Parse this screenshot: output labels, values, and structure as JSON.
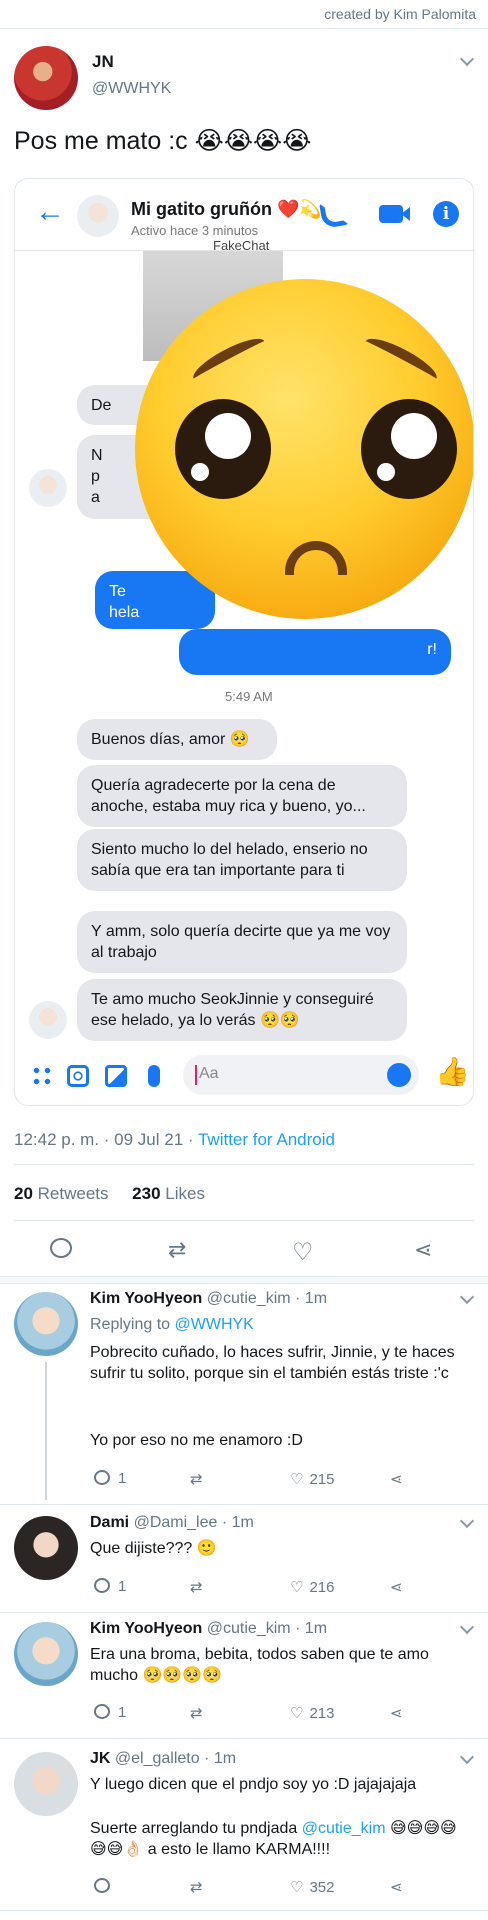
{
  "credit": "created by Kim Palomita",
  "tweet": {
    "name": "JN",
    "handle": "@WWHYK",
    "text": "Pos me mato :c 😭😭😭😭",
    "embedded_chat": {
      "contact_name": "Mi gatito gruñón ❤️💫",
      "status": "Activo hace 3 minutos",
      "watermark": "FakeChat",
      "partial_grey_1": "De",
      "partial_grey_2": "N",
      "partial_grey_2b": "p",
      "partial_grey_2c": "a",
      "partial_blue_1": "Te",
      "partial_blue_1b": "hela",
      "partial_blue_2": "r!",
      "time": "5:49 AM",
      "messages": [
        "Buenos días, amor 🥺",
        "Quería agradecerte por la cena de anoche, estaba muy rica y bueno, yo...",
        "Siento mucho lo del helado, enserio no sabía que era tan importante para ti",
        "Y amm, solo quería decirte que ya me voy al trabajo",
        "Te amo mucho SeokJinnie y conseguiré ese helado, ya lo verás 🥺🥺"
      ],
      "input_placeholder": "Aa",
      "overlay_emoji": "pleading-face"
    },
    "meta": {
      "time": "12:42 p. m. · 09 Jul 21 ·",
      "source": "Twitter for Android"
    },
    "stats": {
      "retweets_count": "20",
      "retweets_label": "Retweets",
      "likes_count": "230",
      "likes_label": "Likes"
    }
  },
  "replies": [
    {
      "name": "Kim YooHyeon",
      "handle_time": "@cutie_kim · 1m",
      "replying_label": "Replying to",
      "replying_to": "@WWHYK",
      "text_1": "Pobrecito cuñado, lo haces sufrir, Jinnie, y te haces sufrir tu solito, porque sin el también estás triste :'c",
      "text_2": "Yo por eso no me enamoro :D",
      "reply_count": "1",
      "like_count": "215"
    },
    {
      "name": "Dami",
      "handle_time": "@Dami_lee · 1m",
      "text_1": "Que dijiste??? 🙂",
      "reply_count": "1",
      "like_count": "216"
    },
    {
      "name": "Kim YooHyeon",
      "handle_time": "@cutie_kim · 1m",
      "text_1": "Era una broma, bebita, todos saben que te amo mucho 🥺🥺🥺🥺",
      "reply_count": "1",
      "like_count": "213"
    },
    {
      "name": "JK",
      "handle_time": "@el_galleto · 1m",
      "text_1": "Y luego dicen que el pndjo soy yo :D jajajajaja",
      "text_2a": "Suerte arreglando tu pndjada",
      "text_2_mention": "@cutie_kim",
      "text_2b": "😅😅😅😅😅😅👌🏻 a esto le llamo KARMA!!!!",
      "like_count": "352"
    }
  ]
}
